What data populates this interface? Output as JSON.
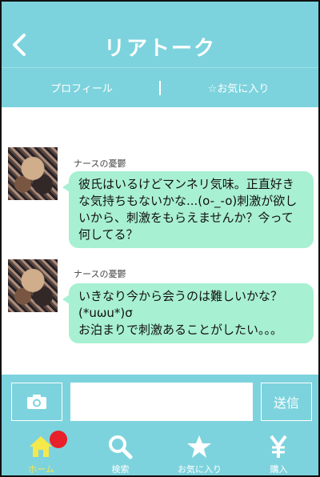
{
  "header": {
    "title": "リアトーク"
  },
  "subnav": {
    "profile_label": "プロフィール",
    "favorite_label": "☆お気に入り"
  },
  "messages": [
    {
      "sender": "ナースの憂鬱",
      "text": "彼氏はいるけどマンネリ気味。正直好きな気持ちもないかな...(o-_-o)刺激が欲しいから、刺激をもらえませんか？今って何してる？"
    },
    {
      "sender": "ナースの憂鬱",
      "text": "いきなり今から会うのは難しいかな？(*uωu*)σ\nお泊まりで刺激あることがしたい。。。"
    }
  ],
  "inputbar": {
    "send_label": "送信",
    "input_value": ""
  },
  "bottomnav": {
    "items": [
      {
        "label": "ホーム",
        "icon": "home-icon",
        "active": true
      },
      {
        "label": "検索",
        "icon": "search-icon"
      },
      {
        "label": "お気に入り",
        "icon": "star-icon"
      },
      {
        "label": "購入",
        "icon": "yen-icon"
      }
    ]
  },
  "colors": {
    "accent": "#7dd3dd",
    "bubble": "#a8f0d2",
    "active": "#f5e84a",
    "badge": "#e8202a"
  }
}
